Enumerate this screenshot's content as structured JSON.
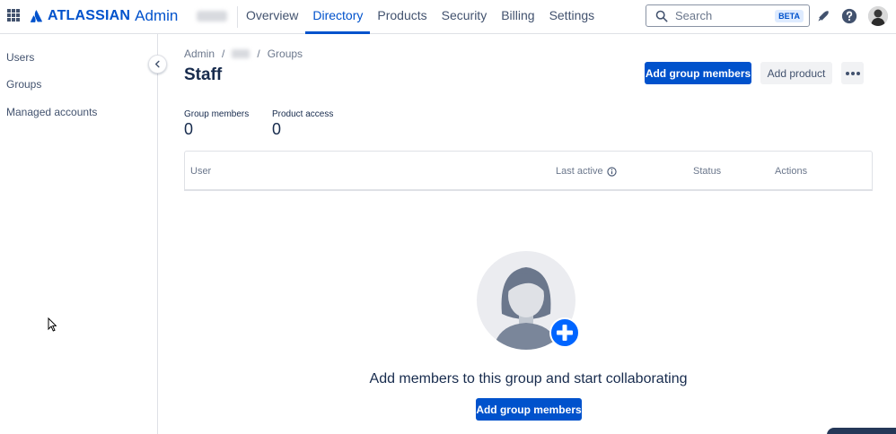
{
  "header": {
    "brand": "ATLASSIAN",
    "product": "Admin",
    "nav": [
      {
        "label": "Overview"
      },
      {
        "label": "Directory"
      },
      {
        "label": "Products"
      },
      {
        "label": "Security"
      },
      {
        "label": "Billing"
      },
      {
        "label": "Settings"
      }
    ],
    "search": {
      "placeholder": "Search",
      "badge": "BETA"
    }
  },
  "sidebar": {
    "items": [
      {
        "label": "Users"
      },
      {
        "label": "Groups"
      },
      {
        "label": "Managed accounts"
      }
    ]
  },
  "breadcrumb": {
    "root": "Admin",
    "separator": "/",
    "current": "Groups"
  },
  "page": {
    "title": "Staff",
    "add_members_label": "Add group members",
    "add_product_label": "Add product"
  },
  "stats": [
    {
      "label": "Group members",
      "value": "0"
    },
    {
      "label": "Product access",
      "value": "0"
    }
  ],
  "table": {
    "columns": [
      "User",
      "Last active",
      "Status",
      "Actions"
    ]
  },
  "empty_state": {
    "title": "Add members to this group and start collaborating",
    "button_label": "Add group members"
  },
  "colors": {
    "primary": "#0052cc",
    "text": "#172b4d",
    "subtle": "#6b778c",
    "border": "#dfe1e6"
  }
}
